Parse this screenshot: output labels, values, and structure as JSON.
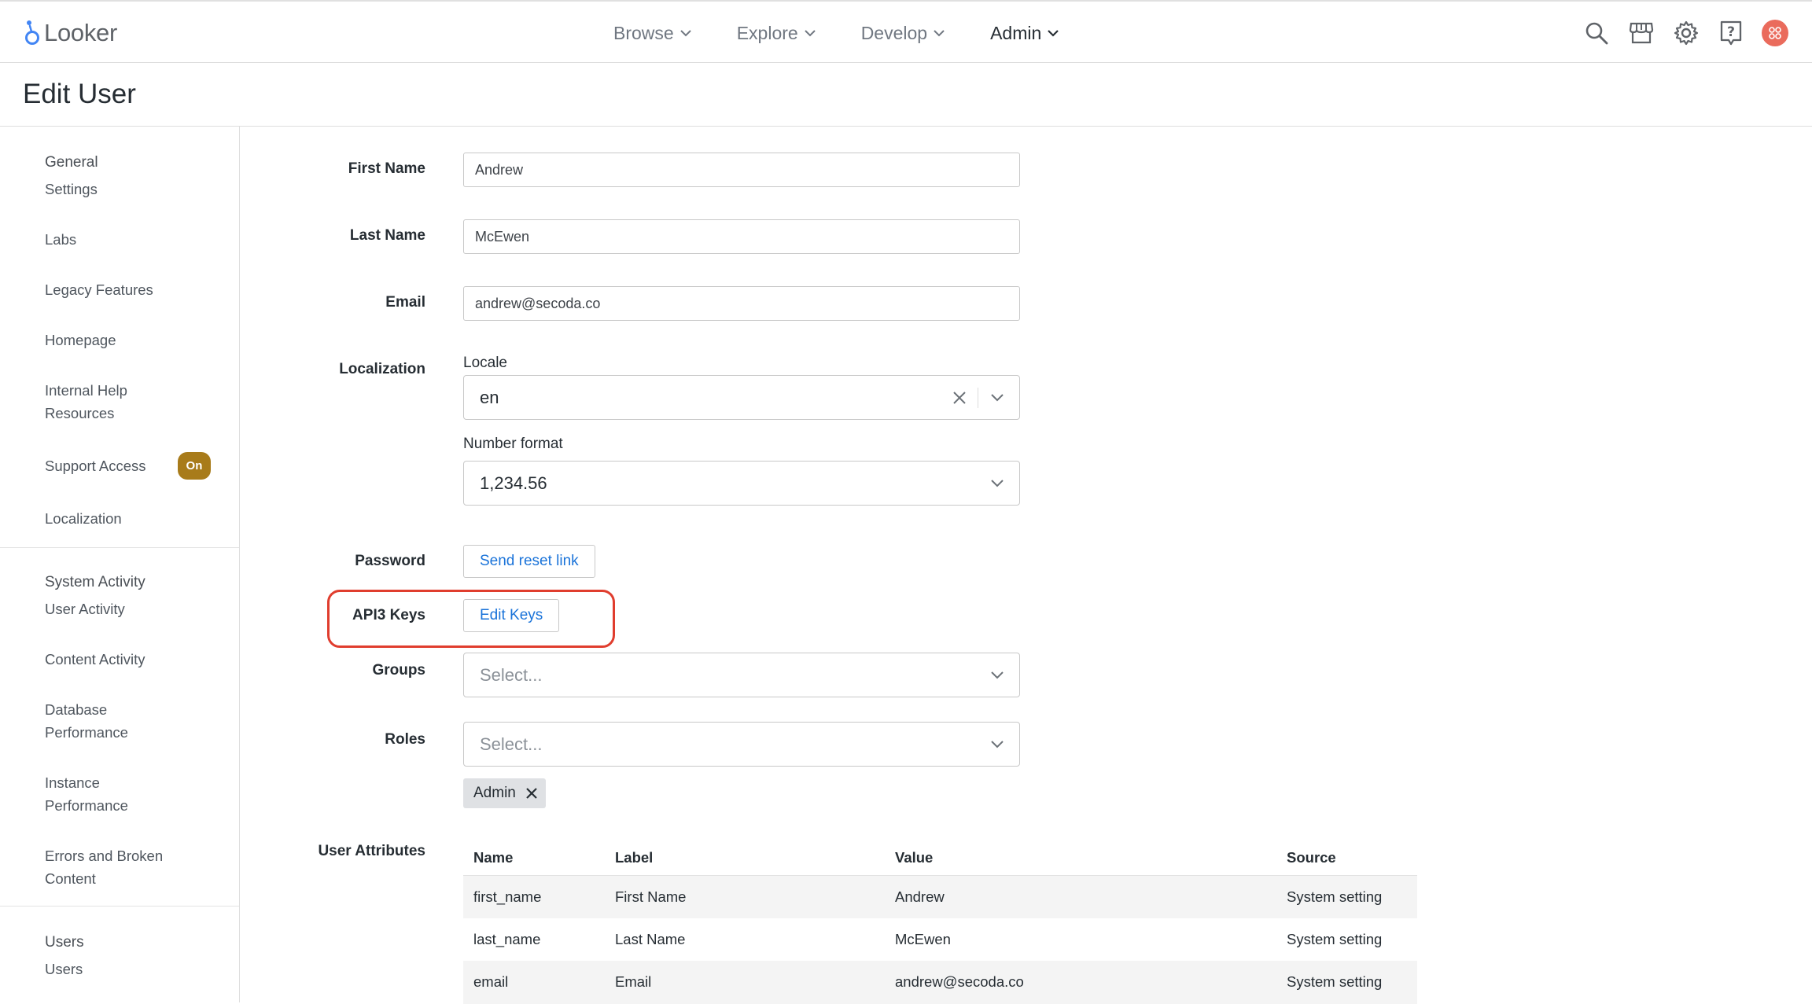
{
  "app": {
    "logo_text": "Looker"
  },
  "nav": {
    "items": [
      {
        "label": "Browse",
        "active": false
      },
      {
        "label": "Explore",
        "active": false
      },
      {
        "label": "Develop",
        "active": false
      },
      {
        "label": "Admin",
        "active": true
      }
    ]
  },
  "top_icons": [
    "search-icon",
    "marketplace-icon",
    "gear-icon",
    "help-icon",
    "avatar"
  ],
  "page": {
    "title": "Edit User"
  },
  "sidebar": {
    "sections": [
      {
        "heading": "General",
        "items": [
          {
            "label": "Settings"
          },
          {
            "label": "Labs"
          },
          {
            "label": "Legacy Features"
          },
          {
            "label": "Homepage"
          },
          {
            "label": "Internal Help Resources"
          },
          {
            "label": "Support Access",
            "badge": "On"
          },
          {
            "label": "Localization"
          }
        ]
      },
      {
        "heading": "System Activity",
        "items": [
          {
            "label": "User Activity"
          },
          {
            "label": "Content Activity"
          },
          {
            "label": "Database Performance"
          },
          {
            "label": "Instance Performance"
          },
          {
            "label": "Errors and Broken Content"
          }
        ]
      },
      {
        "heading": "Users",
        "items": [
          {
            "label": "Users"
          }
        ]
      }
    ]
  },
  "form": {
    "first_name": {
      "label": "First Name",
      "value": "Andrew"
    },
    "last_name": {
      "label": "Last Name",
      "value": "McEwen"
    },
    "email": {
      "label": "Email",
      "value": "andrew@secoda.co"
    },
    "localization": {
      "label": "Localization",
      "locale_caption": "Locale",
      "locale_value": "en",
      "number_format_caption": "Number format",
      "number_format_value": "1,234.56"
    },
    "password": {
      "label": "Password",
      "button": "Send reset link"
    },
    "api_keys": {
      "label": "API3 Keys",
      "button": "Edit Keys"
    },
    "groups": {
      "label": "Groups",
      "placeholder": "Select..."
    },
    "roles": {
      "label": "Roles",
      "placeholder": "Select...",
      "chips": [
        "Admin"
      ]
    },
    "user_attributes": {
      "label": "User Attributes",
      "columns": [
        "Name",
        "Label",
        "Value",
        "Source"
      ],
      "rows": [
        [
          "first_name",
          "First Name",
          "Andrew",
          "System setting"
        ],
        [
          "last_name",
          "Last Name",
          "McEwen",
          "System setting"
        ],
        [
          "email",
          "Email",
          "andrew@secoda.co",
          "System setting"
        ]
      ]
    }
  },
  "colors": {
    "highlight": "#e03d2e",
    "link": "#1a73d9",
    "badge": "#a87b1a",
    "avatar": "#ea6b5c"
  }
}
